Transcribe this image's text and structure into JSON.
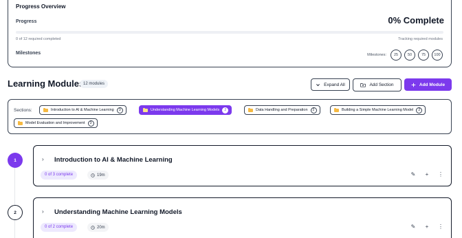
{
  "progress": {
    "title": "Progress Overview",
    "label": "Progress",
    "percent_text": "0% Complete",
    "fraction": 0,
    "completed_text": "0 of 12 required completed",
    "tracking_text": "Tracking required modules",
    "milestones_title": "Milestones",
    "milestones_label": "Milestones:",
    "milestones": [
      "25",
      "50",
      "75",
      "100"
    ]
  },
  "header": {
    "title": "Learning Modules",
    "count": "12 modules",
    "expand_all": "Expand All",
    "add_section": "Add Section",
    "add_module": "Add Module"
  },
  "sections": {
    "label": "Sections:",
    "items": [
      {
        "name": "Introduction to AI & Machine Learning",
        "count": "3",
        "active": false
      },
      {
        "name": "Understanding Machine Learning Models",
        "count": "2",
        "active": true
      },
      {
        "name": "Data Handling and Preparation",
        "count": "2",
        "active": false
      },
      {
        "name": "Building a Simple Machine Learning Model",
        "count": "2",
        "active": false
      },
      {
        "name": "Model Evaluation and Improvement",
        "count": "3",
        "active": false
      }
    ]
  },
  "modules": [
    {
      "number": "1",
      "title": "Introduction to AI & Machine Learning",
      "complete": "0 of 3 complete",
      "duration": "19m"
    },
    {
      "number": "2",
      "title": "Understanding Machine Learning Models",
      "complete": "0 of 2 complete",
      "duration": "20m"
    }
  ],
  "colors": {
    "accent": "#7c3aed",
    "folder": "#f5b942"
  },
  "icons": {
    "expand": "chevron-down-icon",
    "add_section": "folder-plus-icon",
    "add_module": "plus-icon",
    "edit": "pencil-icon",
    "add": "plus-icon",
    "more": "more-vertical-icon",
    "time": "clock-icon"
  }
}
